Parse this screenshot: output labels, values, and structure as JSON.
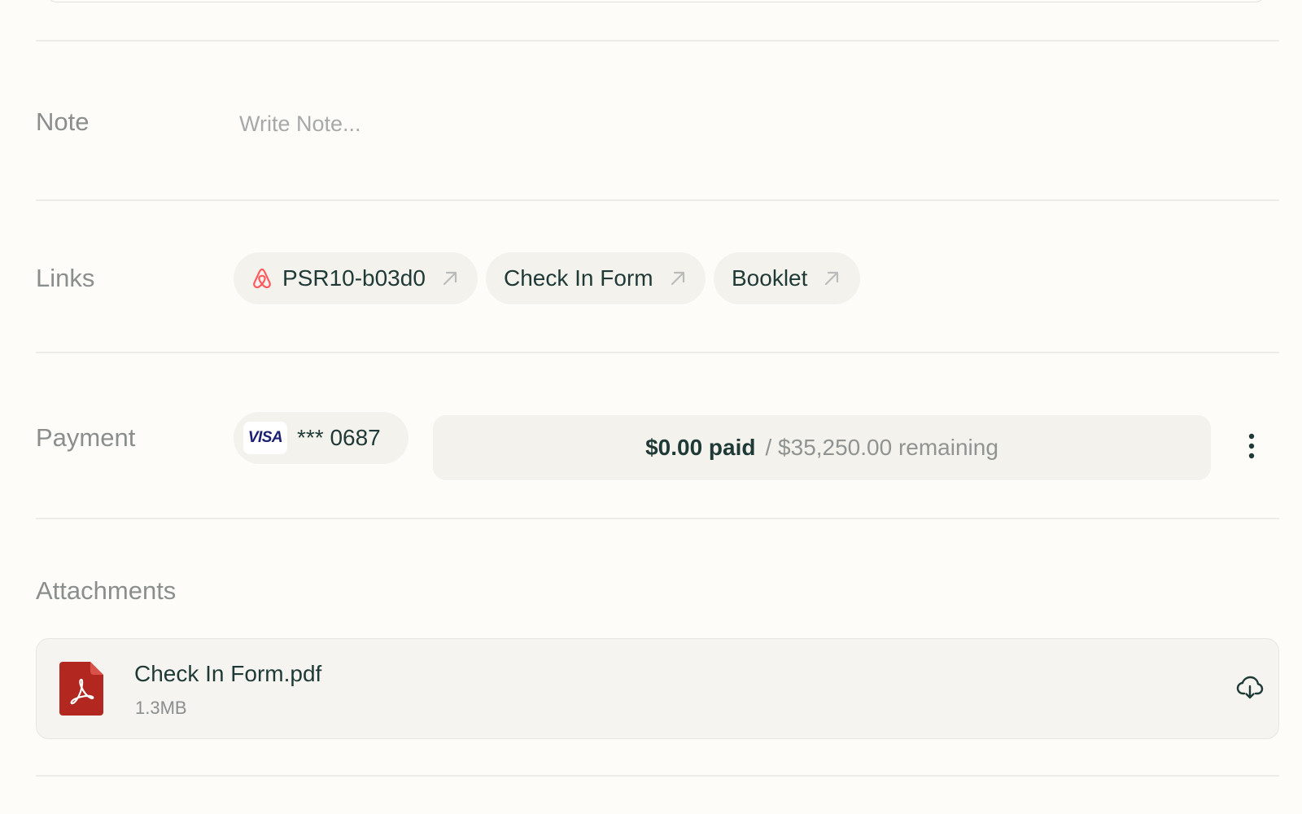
{
  "note": {
    "label": "Note",
    "placeholder": "Write Note..."
  },
  "links": {
    "label": "Links",
    "items": [
      {
        "label": "PSR10-b03d0",
        "icon": "airbnb-icon",
        "trailing_icon": "external-arrow-icon"
      },
      {
        "label": "Check In Form",
        "trailing_icon": "external-arrow-icon"
      },
      {
        "label": "Booklet",
        "trailing_icon": "external-arrow-icon"
      }
    ]
  },
  "payment": {
    "label": "Payment",
    "card_brand": "VISA",
    "card_number": "*** 0687",
    "paid_text": "$0.00 paid",
    "remaining_text": "/ $35,250.00 remaining",
    "menu_icon": "more-vertical-icon"
  },
  "attachments": {
    "label": "Attachments",
    "files": [
      {
        "name": "Check In Form.pdf",
        "size": "1.3MB",
        "icon": "pdf-file-icon",
        "action_icon": "download-cloud-icon"
      }
    ]
  },
  "colors": {
    "background": "#fdfcf9",
    "pill_background": "#f4f2ed",
    "text_primary": "#1f3a36",
    "text_muted": "#8a8e8c",
    "airbnb": "#ff5a5f",
    "visa_blue": "#1a1f71",
    "pdf_red": "#b22720"
  }
}
